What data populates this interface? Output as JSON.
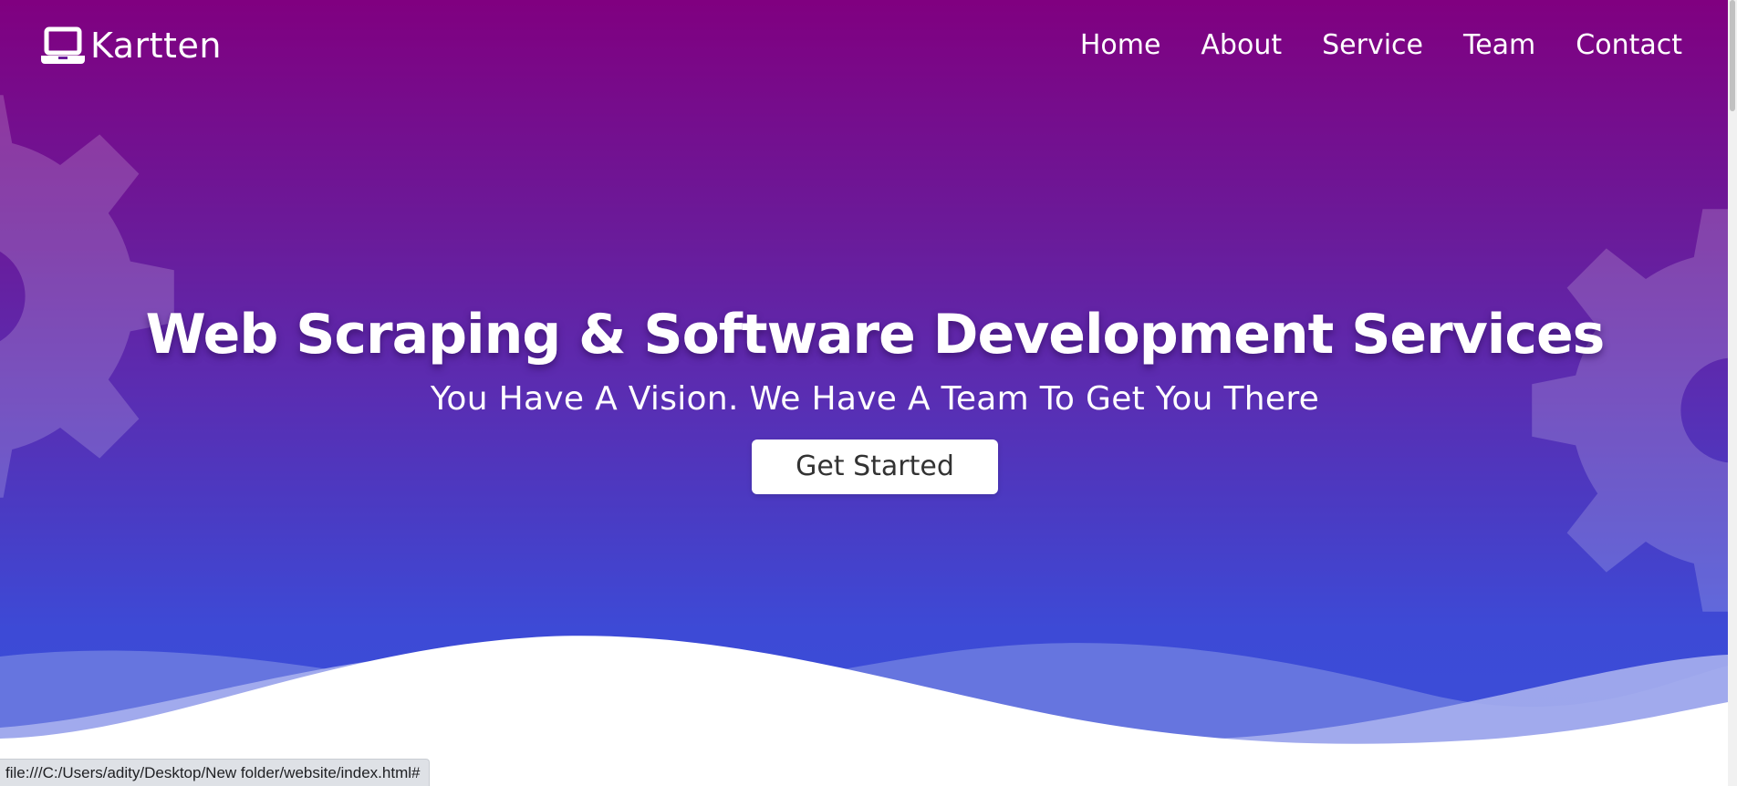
{
  "brand": {
    "name": "Kartten",
    "icon": "laptop-icon"
  },
  "nav": {
    "items": [
      {
        "label": "Home"
      },
      {
        "label": "About"
      },
      {
        "label": "Service"
      },
      {
        "label": "Team"
      },
      {
        "label": "Contact"
      }
    ]
  },
  "hero": {
    "title": "Web Scraping & Software Development Services",
    "subtitle": "You Have A Vision. We Have A Team To Get You There",
    "cta_label": "Get Started",
    "decor_icons": [
      "gear-icon",
      "gear-icon"
    ]
  },
  "status_bar": {
    "url": "file:///C:/Users/adity/Desktop/New folder/website/index.html#"
  },
  "colors": {
    "gradient_top": "#800080",
    "gradient_bottom": "#3a4fd9",
    "text": "#ffffff",
    "button_text": "#333333"
  }
}
